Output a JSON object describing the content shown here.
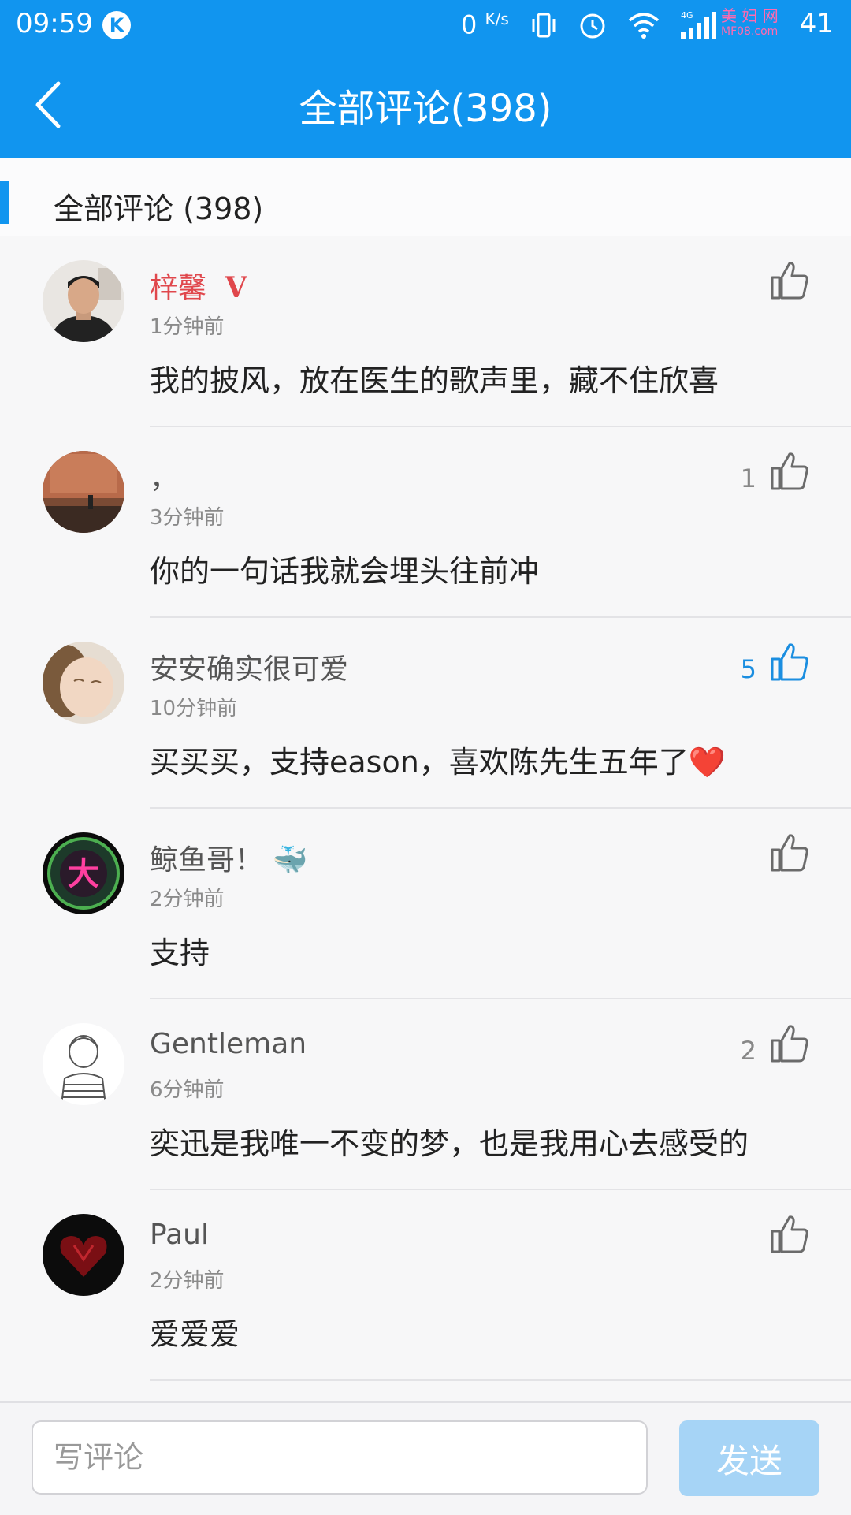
{
  "status_bar": {
    "time": "09:59",
    "k_badge": "K",
    "net_speed": "0",
    "net_unit": "K/s",
    "battery": "41",
    "watermark_line1": "美 妇 网",
    "watermark_line2": "MF08.com"
  },
  "header": {
    "title": "全部评论(398)"
  },
  "section": {
    "label": "全部评论 (398)"
  },
  "comments": [
    {
      "name": "梓馨",
      "vip_badge": "V",
      "time": "1分钟前",
      "text": "我的披风，放在医生的歌声里，藏不住欣喜",
      "likes": ""
    },
    {
      "name": "，",
      "time": "3分钟前",
      "text": "你的一句话我就会埋头往前冲",
      "likes": "1"
    },
    {
      "name": "安安确实很可爱",
      "time": "10分钟前",
      "text": "买买买，支持eason，喜欢陈先生五年了❤️",
      "likes": "5"
    },
    {
      "name": "鲸鱼哥！ 🐳",
      "time": "2分钟前",
      "text": "支持",
      "likes": ""
    },
    {
      "name": "Gentleman",
      "time": "6分钟前",
      "text": "奕迅是我唯一不变的梦，也是我用心去感受的",
      "likes": "2"
    },
    {
      "name": "Paul",
      "time": "2分钟前",
      "text": "爱爱爱",
      "likes": ""
    }
  ],
  "composer": {
    "placeholder": "写评论",
    "value": "",
    "send_label": "发送"
  },
  "colors": {
    "brand": "#1195ef",
    "vip_name": "#e0474c",
    "liked": "#1b8ee0",
    "send_disabled": "#a6d4f6"
  }
}
